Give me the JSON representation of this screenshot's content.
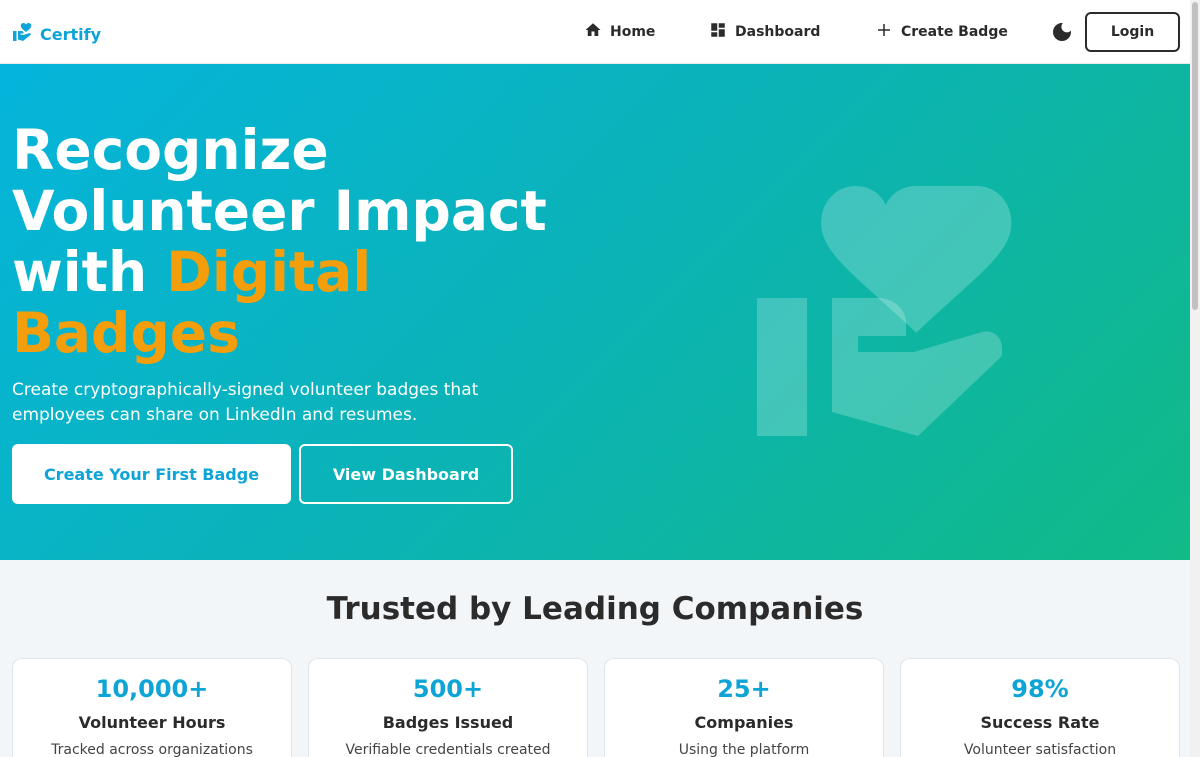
{
  "brand": {
    "name": "Certify",
    "icon": "hand-heart-icon",
    "color": "#0ea5d6"
  },
  "nav": {
    "items": [
      {
        "label": "Home",
        "icon": "home-icon"
      },
      {
        "label": "Dashboard",
        "icon": "dashboard-icon"
      },
      {
        "label": "Create Badge",
        "icon": "plus-icon"
      }
    ],
    "theme_toggle_icon": "moon-icon",
    "login_label": "Login"
  },
  "hero": {
    "title_plain": "Recognize Volunteer Impact with ",
    "title_accent": "Digital Badges",
    "subtitle": "Create cryptographically-signed volunteer badges that employees can share on LinkedIn and resumes.",
    "primary_button": "Create Your First Badge",
    "secondary_button": "View Dashboard",
    "illustration": "hand-heart-icon",
    "gradient": [
      "#05b4dc",
      "#11ba86"
    ],
    "accent_color": "#f59e0b"
  },
  "trusted": {
    "title": "Trusted by Leading Companies",
    "stats": [
      {
        "value": "10,000+",
        "label": "Volunteer Hours",
        "desc": "Tracked across organizations"
      },
      {
        "value": "500+",
        "label": "Badges Issued",
        "desc": "Verifiable credentials created"
      },
      {
        "value": "25+",
        "label": "Companies",
        "desc": "Using the platform"
      },
      {
        "value": "98%",
        "label": "Success Rate",
        "desc": "Volunteer satisfaction"
      }
    ]
  }
}
